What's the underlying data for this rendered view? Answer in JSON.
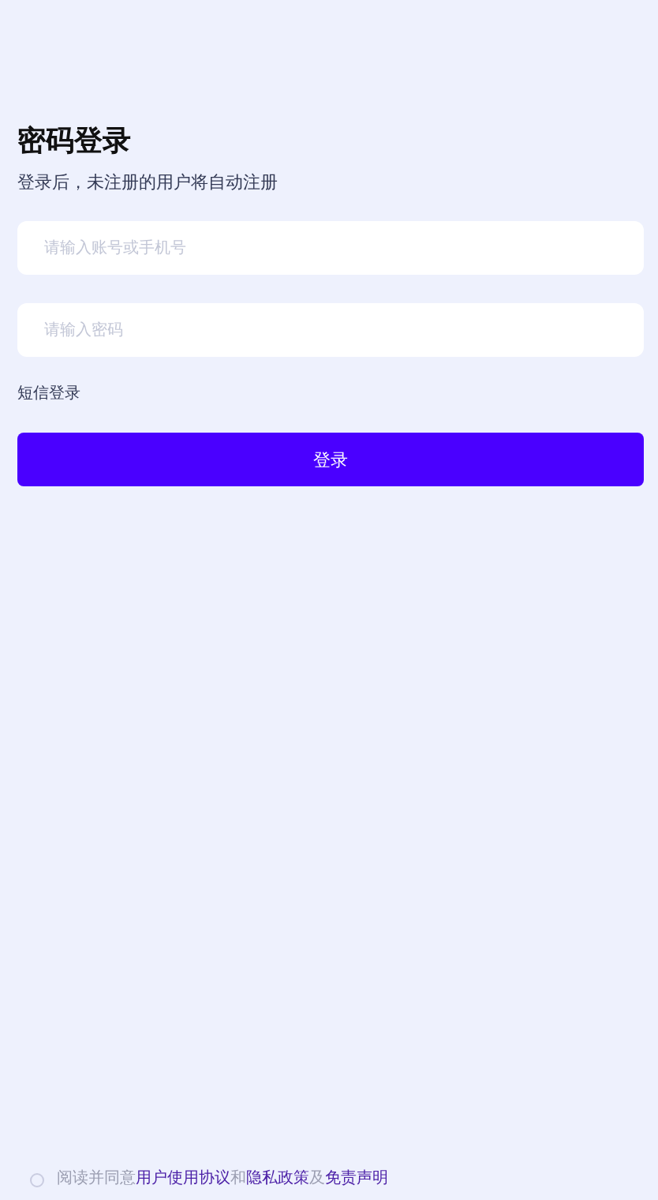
{
  "header": {
    "title": "密码登录",
    "subtitle": "登录后，未注册的用户将自动注册"
  },
  "account_field": {
    "placeholder": "请输入账号或手机号"
  },
  "password_field": {
    "placeholder": "请输入密码"
  },
  "sms_login_link": "短信登录",
  "login_button": "登录",
  "agreement": {
    "checked": false,
    "parts": [
      {
        "kind": "text",
        "text": "阅读并同意"
      },
      {
        "kind": "link",
        "text": "用户使用协议"
      },
      {
        "kind": "text",
        "text": "和"
      },
      {
        "kind": "link",
        "text": "隐私政策"
      },
      {
        "kind": "text",
        "text": "及"
      },
      {
        "kind": "link",
        "text": "免责声明"
      }
    ]
  }
}
